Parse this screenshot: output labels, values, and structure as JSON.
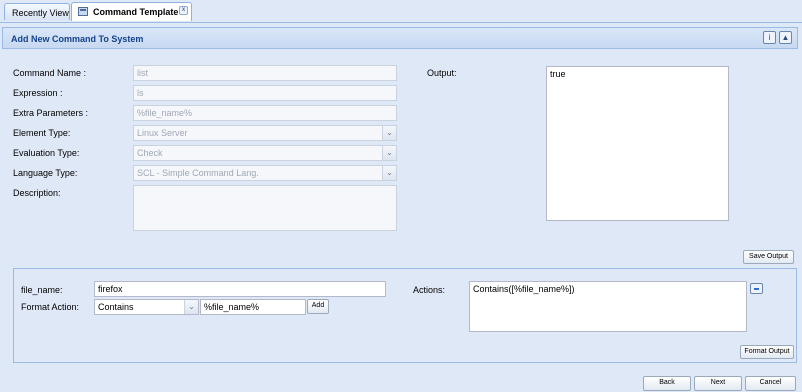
{
  "tabs": [
    {
      "label": "Recently View",
      "active": false
    },
    {
      "label": "Command Template",
      "active": true,
      "icon": "window-icon",
      "close": "x"
    }
  ],
  "panel": {
    "title": "Add New Command To System",
    "header_buttons": [
      "help-icon",
      "collapse-up-icon"
    ]
  },
  "form": {
    "command_name": {
      "label": "Command Name :",
      "value": "list"
    },
    "expression": {
      "label": "Expression :",
      "value": "ls"
    },
    "extra_parameters": {
      "label": "Extra Parameters :",
      "value": "%file_name%"
    },
    "element_type": {
      "label": "Element Type:",
      "value": "Linux Server"
    },
    "evaluation_type": {
      "label": "Evaluation Type:",
      "value": "Check"
    },
    "language_type": {
      "label": "Language Type:",
      "value": "SCL - Simple Command Lang."
    },
    "description": {
      "label": "Description:",
      "value": ""
    }
  },
  "output": {
    "label": "Output:",
    "value": "true",
    "save_button": "Save Output"
  },
  "lower": {
    "file_name": {
      "label": "file_name:",
      "value": "firefox"
    },
    "format_action": {
      "label": "Format Action:",
      "select_value": "Contains",
      "param_value": "%file_name%",
      "add_button": "Add"
    },
    "actions": {
      "label": "Actions:",
      "value": "Contains([%file_name%])"
    },
    "format_output_button": "Format Output"
  },
  "footer": {
    "back": "Back",
    "next": "Next",
    "cancel": "Cancel"
  },
  "colors": {
    "accent": "#15428b",
    "border": "#99bbe8",
    "background": "#dfe8f6"
  }
}
